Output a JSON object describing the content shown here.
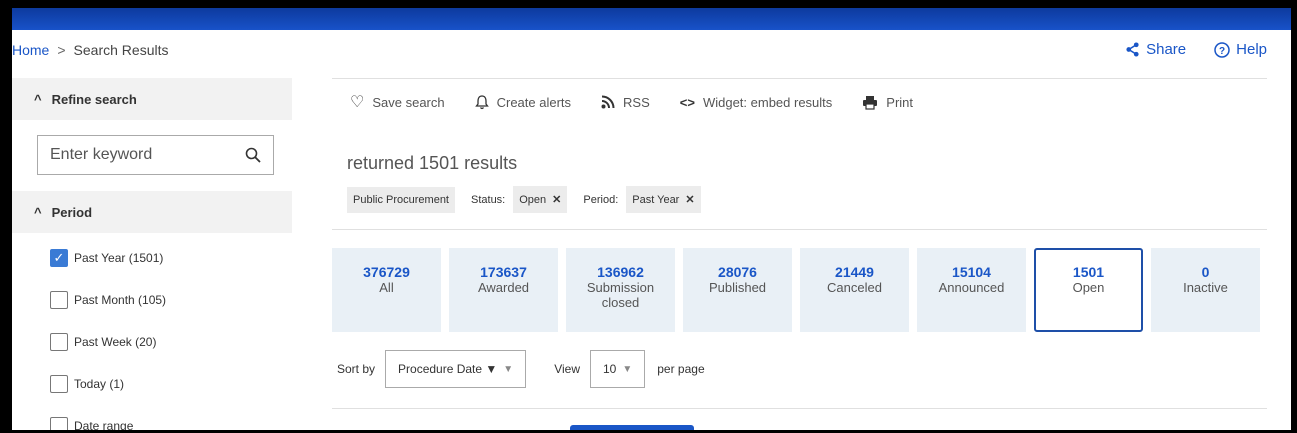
{
  "breadcrumb": {
    "home": "Home",
    "separator": ">",
    "current": "Search Results"
  },
  "top_actions": {
    "share": "Share",
    "help": "Help"
  },
  "sidebar": {
    "refine_title": "Refine search",
    "keyword_placeholder": "Enter keyword",
    "period_title": "Period",
    "options": [
      {
        "label": "Past Year (1501)",
        "checked": true
      },
      {
        "label": "Past Month (105)",
        "checked": false
      },
      {
        "label": "Past Week (20)",
        "checked": false
      },
      {
        "label": "Today (1)",
        "checked": false
      },
      {
        "label": "Date range",
        "checked": false
      }
    ]
  },
  "toolbar": {
    "save": "Save search",
    "alerts": "Create alerts",
    "rss": "RSS",
    "widget": "Widget: embed results",
    "print": "Print"
  },
  "results": {
    "returned_text": "returned 1501 results"
  },
  "filters": {
    "category": "Public Procurement",
    "status_label": "Status:",
    "status_value": "Open",
    "period_label": "Period:",
    "period_value": "Past Year"
  },
  "status_cards": [
    {
      "count": "376729",
      "label": "All",
      "active": false
    },
    {
      "count": "173637",
      "label": "Awarded",
      "active": false
    },
    {
      "count": "136962",
      "label": "Submission closed",
      "active": false
    },
    {
      "count": "28076",
      "label": "Published",
      "active": false
    },
    {
      "count": "21449",
      "label": "Canceled",
      "active": false
    },
    {
      "count": "15104",
      "label": "Announced",
      "active": false
    },
    {
      "count": "1501",
      "label": "Open",
      "active": true
    },
    {
      "count": "0",
      "label": "Inactive",
      "active": false
    }
  ],
  "sort": {
    "sort_label": "Sort by",
    "sort_value": "Procedure Date ▼",
    "view_label": "View",
    "view_value": "10",
    "per_page": "per page"
  },
  "colors": {
    "accent": "#1a56c7",
    "card_bg": "#e9f0f6",
    "header_blue": "#1852c9"
  }
}
